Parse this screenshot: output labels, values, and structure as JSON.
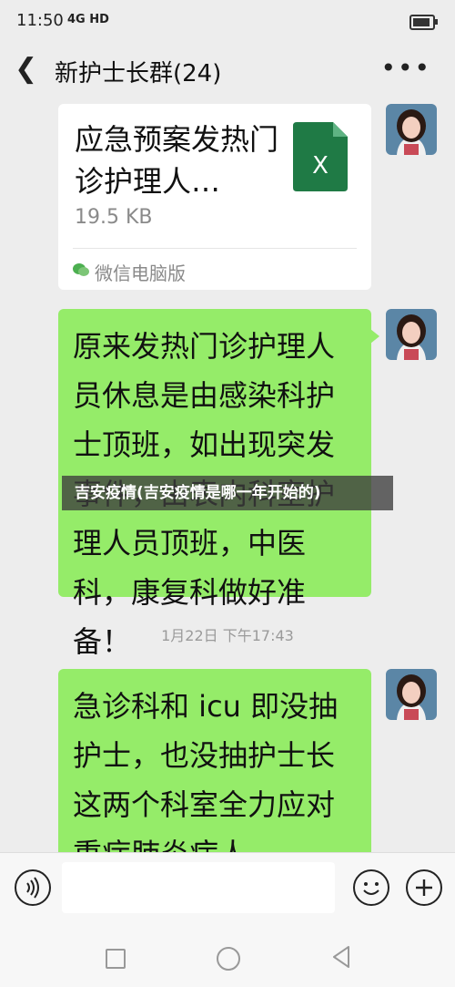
{
  "status_bar": {
    "time": "11:50",
    "network": "4G HD"
  },
  "header": {
    "title": "新护士长群(24)",
    "back_icon": "chevron-left-icon",
    "more_icon": "more-dots-icon"
  },
  "messages": [
    {
      "type": "file",
      "file_name": "应急预案发热门诊护理人…",
      "file_size": "19.5 KB",
      "source": "微信电脑版",
      "file_icon": "excel-icon"
    },
    {
      "type": "text",
      "text": "原来发热门诊护理人员休息是由感染科护士顶班，如出现突发事件，由表内科室护理人员顶班，中医科，康复科做好准备！"
    },
    {
      "type": "timestamp",
      "text": "1月22日 下午17:43"
    },
    {
      "type": "text",
      "text": "急诊科和 icu 即没抽护士，也没抽护士长这两个科室全力应对重症肺炎病人"
    }
  ],
  "overlay_caption": "吉安疫情(吉安疫情是哪一年开始的)",
  "input_bar": {
    "voice_icon": "voice-icon",
    "emoji_icon": "emoji-icon",
    "plus_icon": "plus-icon",
    "placeholder": ""
  },
  "colors": {
    "bubble_green": "#95ec69",
    "background": "#ededed",
    "excel_green": "#1f7a45"
  }
}
